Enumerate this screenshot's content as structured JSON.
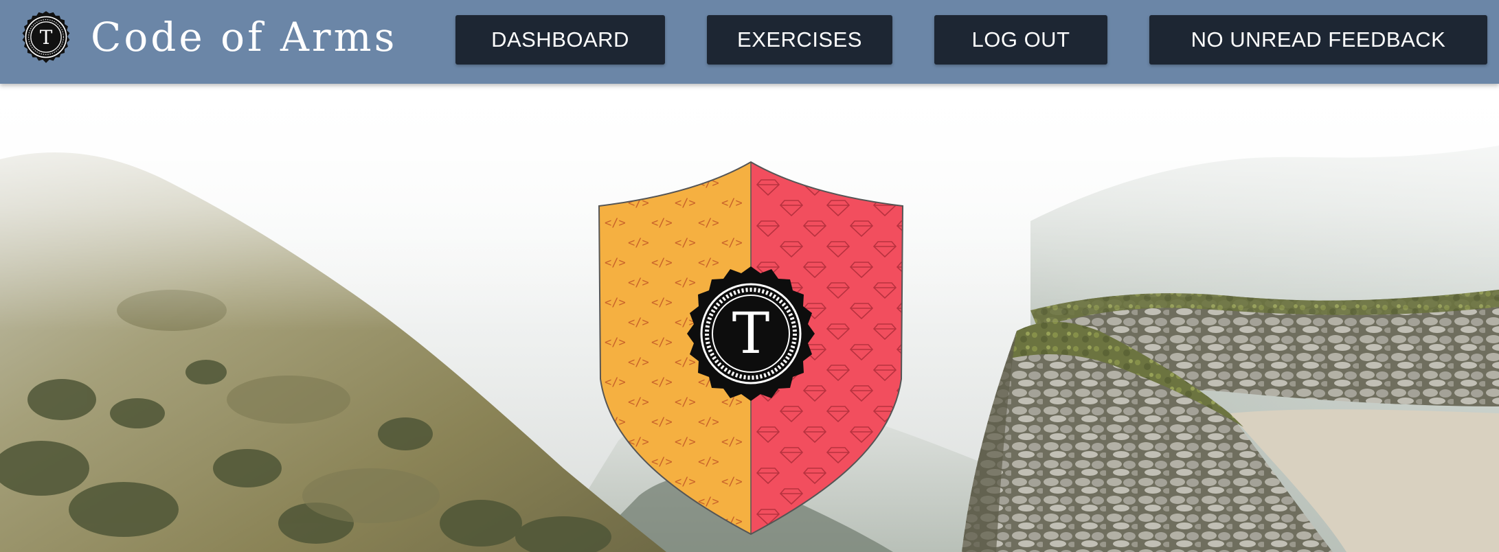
{
  "header": {
    "brand": {
      "title": "Code of Arms",
      "logo_letter": "T"
    },
    "nav": {
      "dashboard_label": "DASHBOARD",
      "exercises_label": "EXERCISES",
      "logout_label": "LOG OUT",
      "feedback_label": "NO UNREAD FEEDBACK"
    }
  },
  "hero": {
    "crest": {
      "center_letter": "T",
      "left_pattern_glyph": "</>",
      "left_color": "#f5b041",
      "right_color": "#f24e5e"
    },
    "background": "misty-mountain-stone-ruins"
  },
  "colors": {
    "header_bg": "#6b86a7",
    "button_bg": "#1d2633",
    "button_text": "#ffffff"
  }
}
